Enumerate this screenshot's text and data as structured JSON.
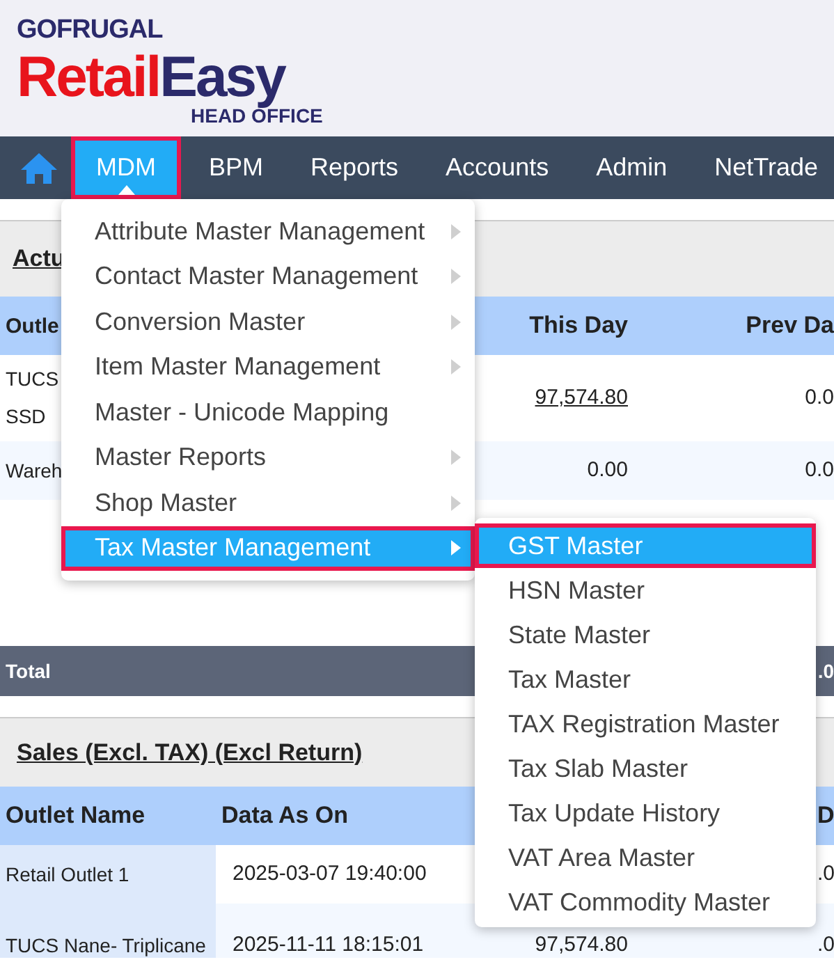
{
  "logo": {
    "brand": "GOFRUGAL",
    "title_parts": [
      {
        "text": "Retail",
        "color": "#e8141c"
      },
      {
        "text": "Easy",
        "color": "#2b2a6b"
      }
    ],
    "subtitle": "HEAD OFFICE"
  },
  "nav": {
    "items": [
      {
        "kind": "home",
        "selected": false
      },
      {
        "kind": "text",
        "label": "MDM",
        "selected": true
      },
      {
        "kind": "text",
        "label": "BPM",
        "selected": false
      },
      {
        "kind": "text",
        "label": "Reports",
        "selected": false
      },
      {
        "kind": "text",
        "label": "Accounts",
        "selected": false
      },
      {
        "kind": "text",
        "label": "Admin",
        "selected": false
      },
      {
        "kind": "text",
        "label": "NetTrade",
        "selected": false
      }
    ]
  },
  "section_1": {
    "title": "Actu",
    "headers": {
      "column_1": "Outle",
      "column_3": "This Day",
      "column_4": "Prev Da"
    },
    "rows": [
      {
        "column_1": [
          "TUCS",
          "SSD"
        ],
        "column_3": {
          "text": "97,574.80",
          "link": true
        },
        "column_4": {
          "text": "0.0",
          "link": false
        }
      },
      {
        "column_1": [
          "Wareh"
        ],
        "column_3": {
          "text": "0.00",
          "link": false
        },
        "column_4": {
          "text": "0.0",
          "link": false
        }
      }
    ],
    "total": {
      "label": "Total",
      "column_4": ".0"
    }
  },
  "section_2": {
    "title": "Sales (Excl. TAX) (Excl Return)",
    "headers": {
      "column_1": "Outlet Name",
      "column_2": "Data As On",
      "column_5": "D"
    },
    "rows": [
      {
        "column_1": "Retail Outlet 1",
        "column_2": "2025-03-07 19:40:00",
        "column_5": ".0"
      },
      {
        "column_1": "TUCS Nane- Triplicane",
        "column_2": "2025-11-11 18:15:01",
        "column_3": "97,574.80",
        "column_5": ".0"
      }
    ]
  },
  "menu": {
    "items": [
      {
        "label": "Attribute Master Management",
        "has_submenu": true,
        "selected": false
      },
      {
        "label": "Contact Master Management",
        "has_submenu": true,
        "selected": false
      },
      {
        "label": "Conversion Master",
        "has_submenu": true,
        "selected": false
      },
      {
        "label": "Item Master Management",
        "has_submenu": true,
        "selected": false
      },
      {
        "label": "Master - Unicode Mapping",
        "has_submenu": false,
        "selected": false
      },
      {
        "label": "Master Reports",
        "has_submenu": true,
        "selected": false
      },
      {
        "label": "Shop Master",
        "has_submenu": true,
        "selected": false
      },
      {
        "label": "Tax Master Management",
        "has_submenu": true,
        "selected": true
      }
    ]
  },
  "submenu": {
    "items": [
      {
        "label": "GST Master",
        "selected": true
      },
      {
        "label": "HSN Master",
        "selected": false
      },
      {
        "label": "State Master",
        "selected": false
      },
      {
        "label": "Tax Master",
        "selected": false
      },
      {
        "label": "TAX Registration Master",
        "selected": false
      },
      {
        "label": "Tax Slab Master",
        "selected": false
      },
      {
        "label": "Tax Update History",
        "selected": false
      },
      {
        "label": "VAT Area Master",
        "selected": false
      },
      {
        "label": "VAT Commodity Master",
        "selected": false
      }
    ]
  }
}
